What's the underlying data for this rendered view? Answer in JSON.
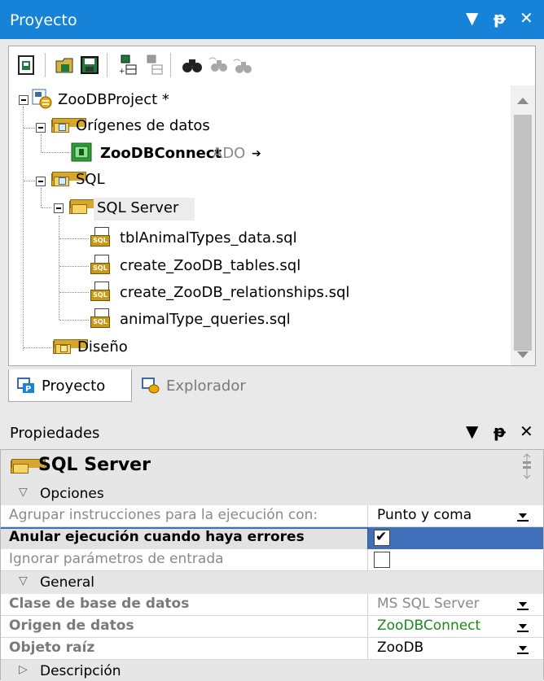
{
  "project_pane": {
    "title": "Proyecto",
    "controls": [
      "▼",
      "ᵽ",
      "✕"
    ],
    "toolbar": [
      "new-project-icon",
      "open-project-icon",
      "save-project-icon",
      "add-to-project-icon",
      "remove-from-project-icon",
      "find-icon",
      "find-next-icon",
      "find-previous-icon"
    ],
    "tree": {
      "root": "ZooDBProject *",
      "data_sources_label": "Orígenes de datos",
      "connection_name": "ZooDBConnect",
      "connection_type": "ADO",
      "connection_arrow": "➔",
      "sql_label": "SQL",
      "sql_server_label": "SQL Server",
      "files": [
        "tblAnimalTypes_data.sql",
        "create_ZooDB_tables.sql",
        "create_ZooDB_relationships.sql",
        "animalType_queries.sql"
      ],
      "design_label": "Diseño"
    },
    "tabs": [
      "Proyecto",
      "Explorador"
    ]
  },
  "properties_pane": {
    "title": "Propiedades",
    "header": "SQL Server",
    "categories": {
      "opciones": "Opciones",
      "general": "General",
      "descripcion": "Descripción"
    },
    "rows": [
      {
        "name": "Agrupar instrucciones para la ejecución con:",
        "value": "Punto y coma"
      },
      {
        "name": "Anular ejecución cuando haya errores",
        "value": "✔"
      },
      {
        "name": "Ignorar parámetros de entrada",
        "value": ""
      },
      {
        "name": "Clase de base de datos",
        "value": "MS SQL Server"
      },
      {
        "name": "Origen de datos",
        "value": "ZooDBConnect"
      },
      {
        "name": "Objeto raíz",
        "value": "ZooDB"
      }
    ]
  },
  "colors": {
    "titlebar": "#1683d8",
    "selection": "#3f6fb8",
    "connection_green": "#1a8a1a"
  }
}
